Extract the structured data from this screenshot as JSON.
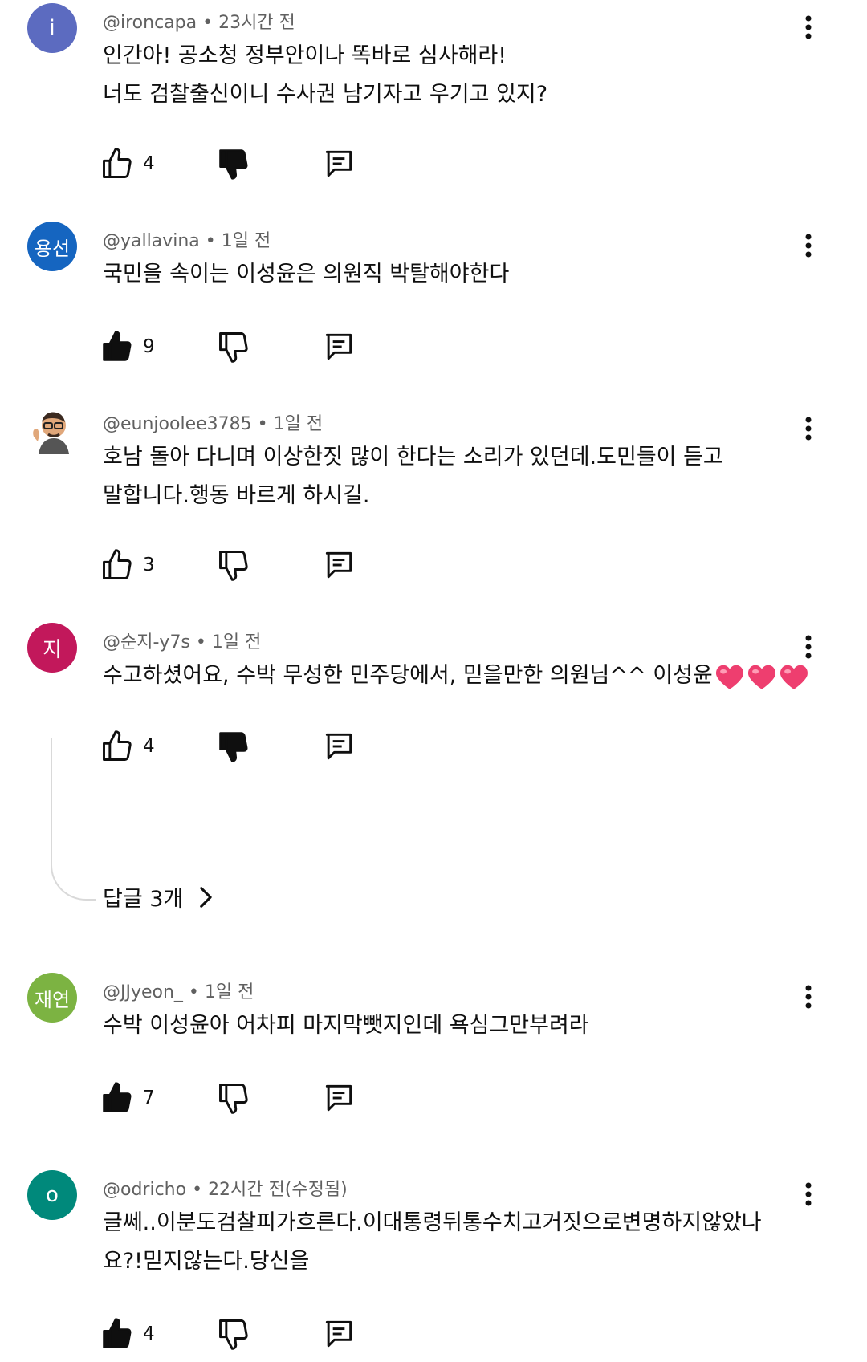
{
  "comments": [
    {
      "avatar_text": "i",
      "avatar_color": "#5c6bc0",
      "handle": "@ironcapa",
      "time": "23시간 전",
      "lines": [
        "인간아! 공소청 정부안이나 똑바로 심사해라!",
        "너도 검찰출신이니 수사권 남기자고 우기고 있지?"
      ],
      "likes": "4",
      "liked": false,
      "disliked": true
    },
    {
      "avatar_text": "용선",
      "avatar_color": "#1565c0",
      "handle": "@yallavina",
      "time": "1일 전",
      "lines": [
        "국민을 속이는 이성윤은 의원직 박탈해야한다"
      ],
      "likes": "9",
      "liked": true,
      "disliked": false
    },
    {
      "avatar_text": "",
      "avatar_color": "#ffffff",
      "handle": "@eunjoolee3785",
      "time": "1일 전",
      "lines": [
        "호남 돌아 다니며 이상한짓 많이 한다는 소리가 있던데.도민들이 듣고",
        "말합니다.행동 바르게 하시길."
      ],
      "likes": "3",
      "liked": false,
      "disliked": false
    },
    {
      "avatar_text": "지",
      "avatar_color": "#c2185b",
      "handle": "@순지-y7s",
      "time": "1일 전",
      "lines": [
        "수고하셨어요, 수박  무성한 민주당에서,  믿을만한 의원님^^ 이성윤"
      ],
      "hearts": 3,
      "likes": "4",
      "liked": false,
      "disliked": true
    },
    {
      "avatar_text": "재연",
      "avatar_color": "#7cb342",
      "handle": "@JJyeon_",
      "time": "1일 전",
      "lines": [
        "수박 이성윤아 어차피 마지막뺏지인데 욕심그만부려라"
      ],
      "likes": "7",
      "liked": true,
      "disliked": false
    },
    {
      "avatar_text": "o",
      "avatar_color": "#00897b",
      "handle": "@odricho",
      "time": "22시간 전(수정됨)",
      "lines": [
        "글쎄..이분도검찰피가흐른다.이대통령뒤통수치고거짓으로변명하지않았나",
        "요?!믿지않는다.당신을"
      ],
      "likes": "4",
      "liked": true,
      "disliked": false
    }
  ],
  "replies_label": "답글 3개",
  "icons": {
    "like": "thumbs-up-icon",
    "dislike": "thumbs-down-icon",
    "reply": "reply-comment-icon",
    "menu": "more-vertical-icon",
    "chevron": "chevron-right-icon",
    "heart": "heart-emoji-icon"
  }
}
